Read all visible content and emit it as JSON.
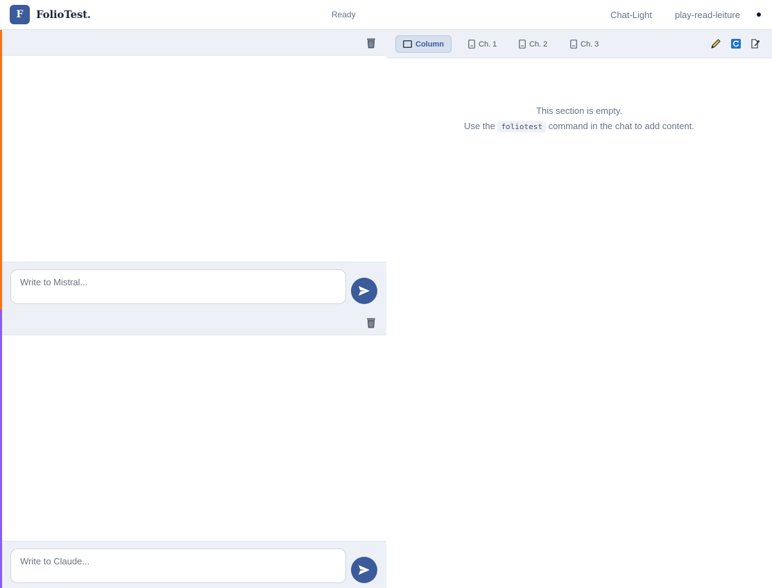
{
  "app": {
    "logo_letter": "F",
    "name": "FolioTest.",
    "status": "Ready",
    "links": [
      "Chat-Light",
      "play-read-leiture"
    ]
  },
  "colors": {
    "brand": "#3b5b9a",
    "pane1_accent": "#f97316",
    "pane2_accent": "#8b5cf6"
  },
  "chats": [
    {
      "placeholder": "Write to Mistral...",
      "header_icon": "trash-icon",
      "send_icon": "send-icon"
    },
    {
      "placeholder": "Write to Claude...",
      "header_icon": "trash-icon",
      "send_icon": "send-icon"
    }
  ],
  "tabs": [
    {
      "label": "Column",
      "icon": "column-icon",
      "active": true
    },
    {
      "label": "Ch. 1",
      "icon": "page-icon",
      "active": false
    },
    {
      "label": "Ch. 2",
      "icon": "page-icon",
      "active": false
    },
    {
      "label": "Ch. 3",
      "icon": "page-icon",
      "active": false
    }
  ],
  "tools": [
    "pencil-icon",
    "refresh-icon",
    "export-icon"
  ],
  "empty_state": {
    "line1": "This section is empty.",
    "line2_before": "Use the",
    "command": "foliotest",
    "line2_after": "command in the chat to add content."
  }
}
